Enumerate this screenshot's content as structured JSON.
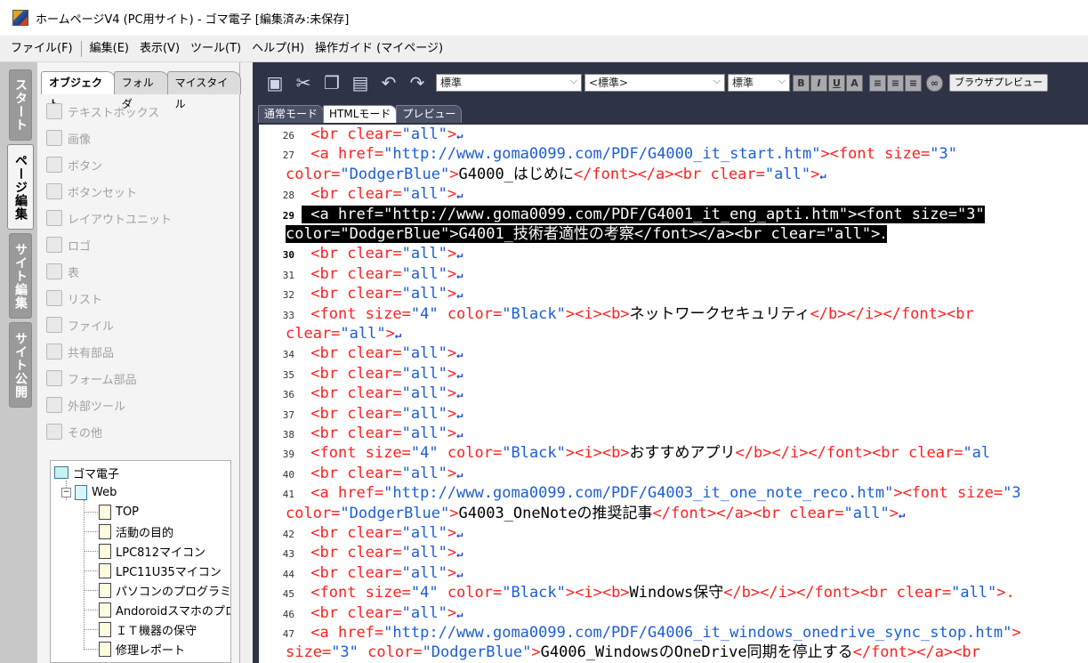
{
  "window": {
    "title": "ホームページV4 (PC用サイト) - ゴマ電子 [編集済み:未保存]"
  },
  "menu": [
    "ファイル(F)",
    "編集(E)",
    "表示(V)",
    "ツール(T)",
    "ヘルプ(H)",
    "操作ガイド (マイページ)"
  ],
  "vtabs": [
    "スタート",
    "ページ編集",
    "サイト編集",
    "サイト公開"
  ],
  "panel": {
    "tabs": [
      "オブジェクト",
      "フォルダ",
      "マイスタイル"
    ],
    "objects": [
      "テキストボックス",
      "画像",
      "ボタン",
      "ボタンセット",
      "レイアウトユニット",
      "ロゴ",
      "表",
      "リスト",
      "ファイル",
      "共有部品",
      "フォーム部品",
      "外部ツール",
      "その他"
    ],
    "tree": {
      "root": "ゴマ電子",
      "web": "Web",
      "pages": [
        "TOP",
        "活動の目的",
        "LPC812マイコン",
        "LPC11U35マイコン",
        "パソコンのプログラミング",
        "Andoroidスマホのプロ",
        "ＩＴ機器の保守",
        "修理レポート"
      ]
    }
  },
  "toolbar": {
    "icons": [
      "save-icon",
      "cut-icon",
      "copy-icon",
      "paste-icon",
      "undo-icon",
      "redo-icon"
    ],
    "style_select": "標準",
    "tag_select": "<標準>",
    "size_select": "標準",
    "format_buttons": [
      "B",
      "I",
      "U",
      "A"
    ],
    "preview_button": "ブラウザプレビュー"
  },
  "mode_tabs": [
    "通常モード",
    "HTMLモード",
    "プレビュー"
  ],
  "code_lines": [
    {
      "n": "26",
      "cont": false,
      "parts": [
        [
          "t",
          "<br "
        ],
        [
          "a",
          "clear="
        ],
        [
          "v",
          "\"all\""
        ],
        [
          "t",
          ">"
        ],
        [
          "nl",
          "↵"
        ]
      ]
    },
    {
      "n": "27",
      "cont": false,
      "parts": [
        [
          "t",
          "<a "
        ],
        [
          "a",
          "href="
        ],
        [
          "v",
          "\"http://www.goma0099.com/PDF/G4000_it_start.htm\""
        ],
        [
          "t",
          "><font "
        ],
        [
          "a",
          "size="
        ],
        [
          "v",
          "\"3\""
        ]
      ]
    },
    {
      "n": "",
      "cont": true,
      "parts": [
        [
          "a",
          "color="
        ],
        [
          "v",
          "\"DodgerBlue\""
        ],
        [
          "t",
          ">"
        ],
        [
          "x",
          "G4000_はじめに"
        ],
        [
          "t",
          "</font></a><br "
        ],
        [
          "a",
          "clear="
        ],
        [
          "v",
          "\"all\""
        ],
        [
          "t",
          ">"
        ],
        [
          "nl",
          "↵"
        ]
      ]
    },
    {
      "n": "28",
      "cont": false,
      "parts": [
        [
          "t",
          "<br "
        ],
        [
          "a",
          "clear="
        ],
        [
          "v",
          "\"all\""
        ],
        [
          "t",
          ">"
        ],
        [
          "nl",
          "↵"
        ]
      ]
    },
    {
      "n": "29",
      "cont": false,
      "sel": true,
      "parts": [
        [
          "t",
          "<a "
        ],
        [
          "a",
          "href="
        ],
        [
          "v",
          "\"http://www.goma0099.com/PDF/G4001_it_eng_apti.htm\""
        ],
        [
          "t",
          "><font "
        ],
        [
          "a",
          "size="
        ],
        [
          "v",
          "\"3\""
        ]
      ]
    },
    {
      "n": "",
      "cont": true,
      "sel": true,
      "parts": [
        [
          "a",
          "color="
        ],
        [
          "v",
          "\"DodgerBlue\""
        ],
        [
          "t",
          ">"
        ],
        [
          "x",
          "G4001_技術者適性の考察"
        ],
        [
          "t",
          "</font></a><br "
        ],
        [
          "a",
          "clear="
        ],
        [
          "v",
          "\"all\""
        ],
        [
          "t",
          ">"
        ],
        [
          "nl",
          "."
        ]
      ]
    },
    {
      "n": "30",
      "cont": false,
      "parts": [
        [
          "t",
          "<br "
        ],
        [
          "a",
          "clear="
        ],
        [
          "v",
          "\"all\""
        ],
        [
          "t",
          ">"
        ],
        [
          "nl",
          "↵"
        ]
      ]
    },
    {
      "n": "31",
      "cont": false,
      "parts": [
        [
          "t",
          "<br "
        ],
        [
          "a",
          "clear="
        ],
        [
          "v",
          "\"all\""
        ],
        [
          "t",
          ">"
        ],
        [
          "nl",
          "↵"
        ]
      ]
    },
    {
      "n": "32",
      "cont": false,
      "parts": [
        [
          "t",
          "<br "
        ],
        [
          "a",
          "clear="
        ],
        [
          "v",
          "\"all\""
        ],
        [
          "t",
          ">"
        ],
        [
          "nl",
          "↵"
        ]
      ]
    },
    {
      "n": "33",
      "cont": false,
      "parts": [
        [
          "t",
          "<font "
        ],
        [
          "a",
          "size="
        ],
        [
          "v",
          "\"4\" "
        ],
        [
          "a",
          "color="
        ],
        [
          "v",
          "\"Black\""
        ],
        [
          "t",
          "><i><b>"
        ],
        [
          "x",
          "ネットワークセキュリティ"
        ],
        [
          "t",
          "</b></i></font><br"
        ]
      ]
    },
    {
      "n": "",
      "cont": true,
      "parts": [
        [
          "a",
          "clear="
        ],
        [
          "v",
          "\"all\""
        ],
        [
          "t",
          ">"
        ],
        [
          "nl",
          "↵"
        ]
      ]
    },
    {
      "n": "34",
      "cont": false,
      "parts": [
        [
          "t",
          "<br "
        ],
        [
          "a",
          "clear="
        ],
        [
          "v",
          "\"all\""
        ],
        [
          "t",
          ">"
        ],
        [
          "nl",
          "↵"
        ]
      ]
    },
    {
      "n": "35",
      "cont": false,
      "parts": [
        [
          "t",
          "<br "
        ],
        [
          "a",
          "clear="
        ],
        [
          "v",
          "\"all\""
        ],
        [
          "t",
          ">"
        ],
        [
          "nl",
          "↵"
        ]
      ]
    },
    {
      "n": "36",
      "cont": false,
      "parts": [
        [
          "t",
          "<br "
        ],
        [
          "a",
          "clear="
        ],
        [
          "v",
          "\"all\""
        ],
        [
          "t",
          ">"
        ],
        [
          "nl",
          "↵"
        ]
      ]
    },
    {
      "n": "37",
      "cont": false,
      "parts": [
        [
          "t",
          "<br "
        ],
        [
          "a",
          "clear="
        ],
        [
          "v",
          "\"all\""
        ],
        [
          "t",
          ">"
        ],
        [
          "nl",
          "↵"
        ]
      ]
    },
    {
      "n": "38",
      "cont": false,
      "parts": [
        [
          "t",
          "<br "
        ],
        [
          "a",
          "clear="
        ],
        [
          "v",
          "\"all\""
        ],
        [
          "t",
          ">"
        ],
        [
          "nl",
          "↵"
        ]
      ]
    },
    {
      "n": "39",
      "cont": false,
      "parts": [
        [
          "t",
          "<font "
        ],
        [
          "a",
          "size="
        ],
        [
          "v",
          "\"4\" "
        ],
        [
          "a",
          "color="
        ],
        [
          "v",
          "\"Black\""
        ],
        [
          "t",
          "><i><b>"
        ],
        [
          "x",
          "おすすめアプリ"
        ],
        [
          "t",
          "</b></i></font><br "
        ],
        [
          "a",
          "clear="
        ],
        [
          "v",
          "\"al"
        ]
      ]
    },
    {
      "n": "40",
      "cont": false,
      "parts": [
        [
          "t",
          "<br "
        ],
        [
          "a",
          "clear="
        ],
        [
          "v",
          "\"all\""
        ],
        [
          "t",
          ">"
        ],
        [
          "nl",
          "↵"
        ]
      ]
    },
    {
      "n": "41",
      "cont": false,
      "parts": [
        [
          "t",
          "<a "
        ],
        [
          "a",
          "href="
        ],
        [
          "v",
          "\"http://www.goma0099.com/PDF/G4003_it_one_note_reco.htm\""
        ],
        [
          "t",
          "><font "
        ],
        [
          "a",
          "size="
        ],
        [
          "v",
          "\"3"
        ]
      ]
    },
    {
      "n": "",
      "cont": true,
      "parts": [
        [
          "a",
          "color="
        ],
        [
          "v",
          "\"DodgerBlue\""
        ],
        [
          "t",
          ">"
        ],
        [
          "x",
          "G4003_OneNoteの推奨記事"
        ],
        [
          "t",
          "</font></a><br "
        ],
        [
          "a",
          "clear="
        ],
        [
          "v",
          "\"all\""
        ],
        [
          "t",
          ">"
        ],
        [
          "nl",
          "↵"
        ]
      ]
    },
    {
      "n": "42",
      "cont": false,
      "parts": [
        [
          "t",
          "<br "
        ],
        [
          "a",
          "clear="
        ],
        [
          "v",
          "\"all\""
        ],
        [
          "t",
          ">"
        ],
        [
          "nl",
          "↵"
        ]
      ]
    },
    {
      "n": "43",
      "cont": false,
      "parts": [
        [
          "t",
          "<br "
        ],
        [
          "a",
          "clear="
        ],
        [
          "v",
          "\"all\""
        ],
        [
          "t",
          ">"
        ],
        [
          "nl",
          "↵"
        ]
      ]
    },
    {
      "n": "44",
      "cont": false,
      "parts": [
        [
          "t",
          "<br "
        ],
        [
          "a",
          "clear="
        ],
        [
          "v",
          "\"all\""
        ],
        [
          "t",
          ">"
        ],
        [
          "nl",
          "↵"
        ]
      ]
    },
    {
      "n": "45",
      "cont": false,
      "parts": [
        [
          "t",
          "<font "
        ],
        [
          "a",
          "size="
        ],
        [
          "v",
          "\"4\" "
        ],
        [
          "a",
          "color="
        ],
        [
          "v",
          "\"Black\""
        ],
        [
          "t",
          "><i><b>"
        ],
        [
          "x",
          "Windows保守"
        ],
        [
          "t",
          "</b></i></font><br "
        ],
        [
          "a",
          "clear="
        ],
        [
          "v",
          "\"all\""
        ],
        [
          "t",
          ">."
        ]
      ]
    },
    {
      "n": "46",
      "cont": false,
      "parts": [
        [
          "t",
          "<br "
        ],
        [
          "a",
          "clear="
        ],
        [
          "v",
          "\"all\""
        ],
        [
          "t",
          ">"
        ],
        [
          "nl",
          "↵"
        ]
      ]
    },
    {
      "n": "47",
      "cont": false,
      "parts": [
        [
          "t",
          "<a "
        ],
        [
          "a",
          "href="
        ],
        [
          "v",
          "\"http://www.goma0099.com/PDF/G4006_it_windows_onedrive_sync_stop.htm\""
        ],
        [
          "t",
          ">"
        ]
      ]
    },
    {
      "n": "",
      "cont": true,
      "parts": [
        [
          "a",
          "size="
        ],
        [
          "v",
          "\"3\" "
        ],
        [
          "a",
          "color="
        ],
        [
          "v",
          "\"DodgerBlue\""
        ],
        [
          "t",
          ">"
        ],
        [
          "x",
          "G4006_WindowsのOneDrive同期を停止する"
        ],
        [
          "t",
          "</font></a><br"
        ]
      ]
    }
  ],
  "colors": {
    "editor_bg": "#2e3346",
    "tag": "#ff2020",
    "value": "#1c5ed6",
    "selection": "#000000"
  }
}
